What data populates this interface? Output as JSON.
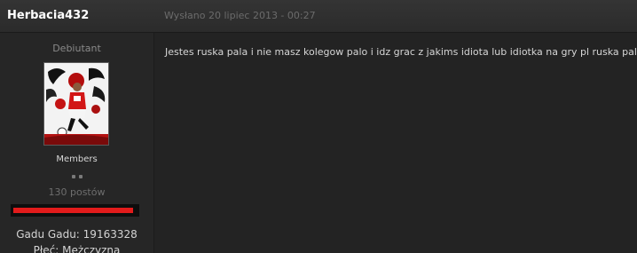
{
  "post": {
    "author": "Herbacia432",
    "date": "Wysłano 20 lipiec 2013 - 00:27",
    "body": "Jestes ruska pala i nie masz kolegow palo i idz grac z jakims idiota lub idiotka na gry pl ruska palo"
  },
  "author_panel": {
    "rank_title": "Debiutant",
    "group": "Members",
    "post_count": "130 postów",
    "reputation_fill": 0.97,
    "fields": [
      {
        "label": "Gadu Gadu:",
        "value": "19163328"
      },
      {
        "label": "Płeć:",
        "value": "Mężczyzna"
      }
    ]
  },
  "colors": {
    "background": "#232323",
    "header": "#2f2f2f",
    "reputation_bar": "#e21b1b"
  },
  "icons": {
    "rank_pips": "two-dot-rank-icon",
    "avatar": "football-player-avatar"
  }
}
